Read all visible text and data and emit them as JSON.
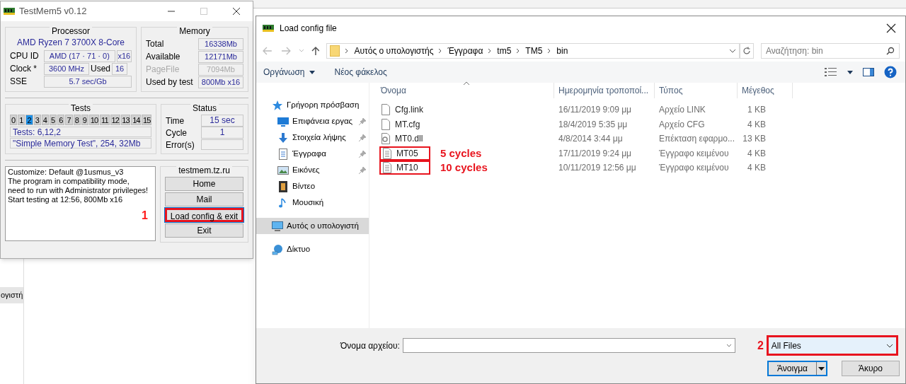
{
  "background": {
    "sidebar_fragment": "ογιστή"
  },
  "testmem": {
    "title": "TestMem5 v0.12",
    "processor": {
      "heading": "Processor",
      "model": "AMD Ryzen 7 3700X 8-Core",
      "rows": [
        {
          "label": "CPU ID",
          "value": "AMD  (17 · 71 · 0)",
          "extra": "x16"
        },
        {
          "label": "Clock *",
          "value": "3600 MHz",
          "extra_label": "Used",
          "extra": "16"
        },
        {
          "label": "SSE",
          "value": "5.7 sec/Gb"
        }
      ]
    },
    "memory": {
      "heading": "Memory",
      "rows": [
        {
          "label": "Total",
          "value": "16338Mb",
          "disabled": false
        },
        {
          "label": "Available",
          "value": "12171Mb",
          "disabled": false
        },
        {
          "label": "PageFile",
          "value": "7094Mb",
          "disabled": true
        },
        {
          "label": "Used by test",
          "value": "800Mb x16",
          "disabled": false
        }
      ]
    },
    "tests": {
      "heading": "Tests",
      "numbers": [
        {
          "label": "0",
          "selected": false
        },
        {
          "label": "1",
          "selected": false
        },
        {
          "label": "2",
          "selected": true
        },
        {
          "label": "3",
          "selected": false
        },
        {
          "label": "4",
          "selected": false
        },
        {
          "label": "5",
          "selected": false
        },
        {
          "label": "6",
          "selected": false
        },
        {
          "label": "7",
          "selected": false
        },
        {
          "label": "8",
          "selected": false
        },
        {
          "label": "9",
          "selected": false
        },
        {
          "label": "10",
          "selected": false
        },
        {
          "label": "11",
          "selected": false
        },
        {
          "label": "12",
          "selected": false
        },
        {
          "label": "13",
          "selected": false
        },
        {
          "label": "14",
          "selected": false
        },
        {
          "label": "15",
          "selected": false
        }
      ],
      "info": [
        "Tests: 6,12,2",
        "\"Simple Memory Test\", 254, 32Mb"
      ]
    },
    "status": {
      "heading": "Status",
      "rows": [
        {
          "label": "Time",
          "value": "15 sec"
        },
        {
          "label": "Cycle",
          "value": "1"
        },
        {
          "label": "Error(s)"
        }
      ]
    },
    "log": [
      "Customize: Default @1usmus_v3",
      "The program in compatibility mode,",
      "need to run with Administrator privileges!",
      "Start testing at 12:56, 800Mb x16"
    ],
    "annotation": "1",
    "links": {
      "heading": "testmem.tz.ru",
      "buttons": [
        {
          "label": "Home",
          "marked": false
        },
        {
          "label": "Mail",
          "marked": false
        },
        {
          "label": "Load config & exit",
          "marked": true
        },
        {
          "label": "Exit",
          "marked": false
        }
      ]
    }
  },
  "dialog": {
    "title": "Load config file",
    "path": [
      "Αυτός ο υπολογιστής",
      "Έγγραφα",
      "tm5",
      "TM5",
      "bin"
    ],
    "search": {
      "placeholder": "Αναζήτηση: bin"
    },
    "toolbar": [
      {
        "label": "Οργάνωση",
        "kind": "menu"
      },
      {
        "label": "Νέος φάκελος",
        "kind": "button"
      }
    ],
    "sidebar": [
      {
        "label": "Γρήγορη πρόσβαση",
        "pinned": false,
        "selected": false
      },
      {
        "label": "Επιφάνεια εργας",
        "pinned": true,
        "selected": false
      },
      {
        "label": "Στοιχεία λήψης",
        "pinned": true,
        "selected": false
      },
      {
        "label": "Έγγραφα",
        "pinned": true,
        "selected": false
      },
      {
        "label": "Εικόνες",
        "pinned": true,
        "selected": false
      },
      {
        "label": "Βίντεο",
        "pinned": false,
        "selected": false
      },
      {
        "label": "Μουσική",
        "pinned": false,
        "selected": false
      },
      {
        "label": "Αυτός ο υπολογιστή",
        "pinned": false,
        "selected": true
      },
      {
        "label": "Δίκτυο",
        "pinned": false,
        "selected": false
      }
    ],
    "columns": [
      "Όνομα",
      "Ημερομηνία τροποποί...",
      "Τύπος",
      "Μέγεθος"
    ],
    "files": [
      {
        "name": "Cfg.link",
        "date": "16/11/2019 9:09 μμ",
        "type": "Αρχείο LINK",
        "size": "1 KB",
        "marked": false
      },
      {
        "name": "MT.cfg",
        "date": "18/4/2019 5:35 μμ",
        "type": "Αρχείο CFG",
        "size": "4 KB",
        "marked": false
      },
      {
        "name": "MT0.dll",
        "date": "4/8/2014 3:44 μμ",
        "type": "Επέκταση εφαρμο...",
        "size": "13 KB",
        "marked": false
      },
      {
        "name": "MT05",
        "date": "17/11/2019 9:24 μμ",
        "type": "Έγγραφο κειμένου",
        "size": "4 KB",
        "marked": true,
        "note": "5 cycles"
      },
      {
        "name": "MT10",
        "date": "10/11/2019 12:56 μμ",
        "type": "Έγγραφο κειμένου",
        "size": "4 KB",
        "marked": true,
        "note": "10 cycles"
      }
    ],
    "filename": {
      "label": "Όνομα αρχείου:"
    },
    "annotation": "2",
    "filetype": {
      "value": "All Files",
      "marked": true
    },
    "buttons": {
      "open": "Άνοιγμα",
      "cancel": "Άκυρο"
    }
  }
}
